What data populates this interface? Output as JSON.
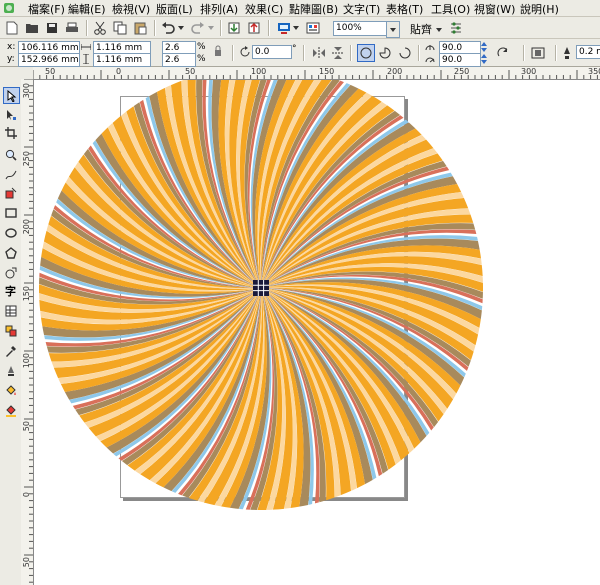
{
  "menubar": {
    "items": [
      "檔案(F)",
      "編輯(E)",
      "檢視(V)",
      "版面(L)",
      "排列(A)",
      "效果(C)",
      "點陣圖(B)",
      "文字(T)",
      "表格(T)",
      "工具(O)",
      "視窗(W)",
      "說明(H)"
    ]
  },
  "toolbar1": {
    "zoom_value": "100%",
    "snap_label": "貼齊"
  },
  "propbar": {
    "x_label": "x:",
    "y_label": "y:",
    "x_value": "106.116 mm",
    "y_value": "152.966 mm",
    "width_value": "1.116 mm",
    "height_value": "1.116 mm",
    "scale_x": "2.6",
    "scale_y": "2.6",
    "percent_symbol": "%",
    "rotation_value": "0.0",
    "degree_symbol": "°",
    "start_angle": "90.0",
    "end_angle": "90.0",
    "outline_width": "0.2 m"
  },
  "ruler": {
    "horizontal_ticks": [
      "50",
      "0",
      "50",
      "100",
      "150",
      "200",
      "250",
      "300",
      "350"
    ],
    "vertical_ticks": [
      "300",
      "250",
      "200",
      "150",
      "100",
      "50",
      "0",
      "50"
    ]
  },
  "colors": {
    "stripe_orange": "#f4a623",
    "stripe_light": "#fcd8a0",
    "stripe_brown": "#a88a5c",
    "stripe_blue": "#8ec8ea",
    "stripe_red": "#d9705a",
    "chrome_bg": "#ecebe4"
  }
}
